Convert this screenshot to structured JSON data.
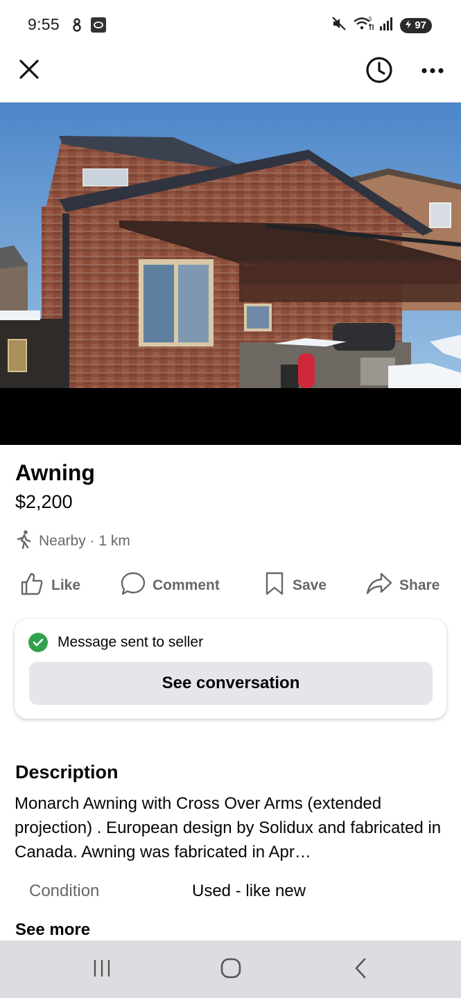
{
  "status_bar": {
    "time": "9:55",
    "battery": "97",
    "left_icons": [
      "notification-icon",
      "app-icon"
    ],
    "right_icons": [
      "mute-icon",
      "wifi-icon",
      "signal-icon",
      "battery-icon"
    ]
  },
  "app_bar": {
    "close_icon": "close-icon",
    "history_icon": "clock-icon",
    "more_icon": "more-icon"
  },
  "listing": {
    "title": "Awning",
    "price": "$2,200",
    "location": "Nearby · 1 km"
  },
  "actions": {
    "like": "Like",
    "comment": "Comment",
    "save": "Save",
    "share": "Share"
  },
  "message_card": {
    "status": "Message sent to seller",
    "button": "See conversation"
  },
  "description": {
    "heading": "Description",
    "text": "Monarch Awning with Cross Over Arms (extended projection) . European  design  by Solidux and fabricated in Canada. Awning was fabricated in Apr…",
    "condition_label": "Condition",
    "condition_value": "Used - like new",
    "see_more": "See more"
  },
  "colors": {
    "text_primary": "#050505",
    "text_secondary": "#65676b",
    "success_green": "#31a24c",
    "button_gray": "#e4e6eb",
    "nav_bar": "#dcdde0"
  }
}
